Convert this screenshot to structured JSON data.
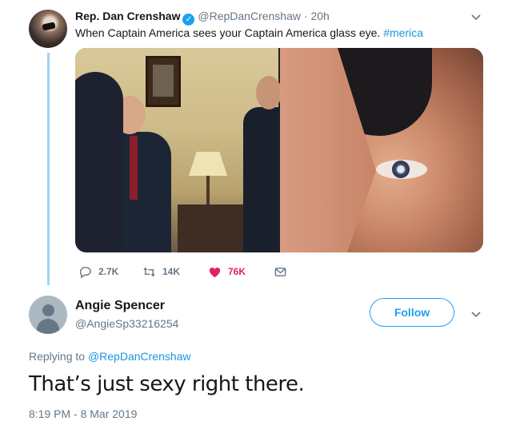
{
  "colors": {
    "accent": "#1da1f2",
    "link": "#1b95e0",
    "like": "#e0245e",
    "muted": "#657786",
    "thread": "#9fd3f4"
  },
  "tweet": {
    "author_name": "Rep. Dan Crenshaw",
    "verified_mark": "✓",
    "handle": "@RepDanCrenshaw",
    "separator": "·",
    "time": "20h",
    "text": "When Captain America sees your Captain America glass eye. ",
    "hashtag": "#merica",
    "icons": [
      "verified-icon",
      "chevron-down-icon",
      "reply-icon",
      "retweet-icon",
      "heart-icon",
      "message-icon"
    ],
    "stats": {
      "replies": "2.7K",
      "retweets": "14K",
      "likes": "76K"
    }
  },
  "reply": {
    "author_name": "Angie Spencer",
    "handle": "@AngieSp33216254",
    "follow_label": "Follow",
    "replying_prefix": "Replying to ",
    "replying_to": "@RepDanCrenshaw",
    "text": "That’s just sexy right there.",
    "timestamp": "8:19 PM - 8 Mar 2019"
  }
}
